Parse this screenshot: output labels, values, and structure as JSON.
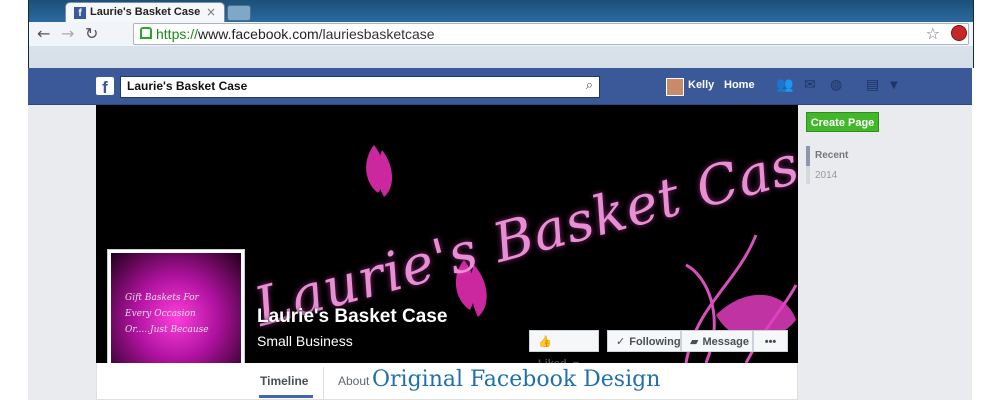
{
  "browser": {
    "tab_title": "Laurie's Basket Case",
    "tab_close": "×",
    "url_https": "https://",
    "url_domain": "www.facebook.com",
    "url_path": "/lauriesbasketcase"
  },
  "fb_bar": {
    "search_value": "Laurie's Basket Case",
    "user_name": "Kelly",
    "home_label": "Home"
  },
  "page": {
    "cover_script": "Laurie's Basket Case",
    "name": "Laurie's Basket Case",
    "category": "Small Business",
    "profile_lines": [
      "Gift Baskets For",
      "Every Occasion",
      "Or.....Just Because"
    ],
    "buttons": {
      "liked": "Liked",
      "following": "Following",
      "message": "Message",
      "more": "•••"
    },
    "tabs": {
      "timeline": "Timeline",
      "about": "About"
    },
    "overlay_caption": "Original Facebook Design"
  },
  "sidebar": {
    "create_page": "Create Page",
    "years": [
      "Recent",
      "2014"
    ]
  },
  "colors": {
    "fb_blue": "#3b5998",
    "create_green": "#42b72a",
    "cover_pink": "#e88fd3"
  }
}
